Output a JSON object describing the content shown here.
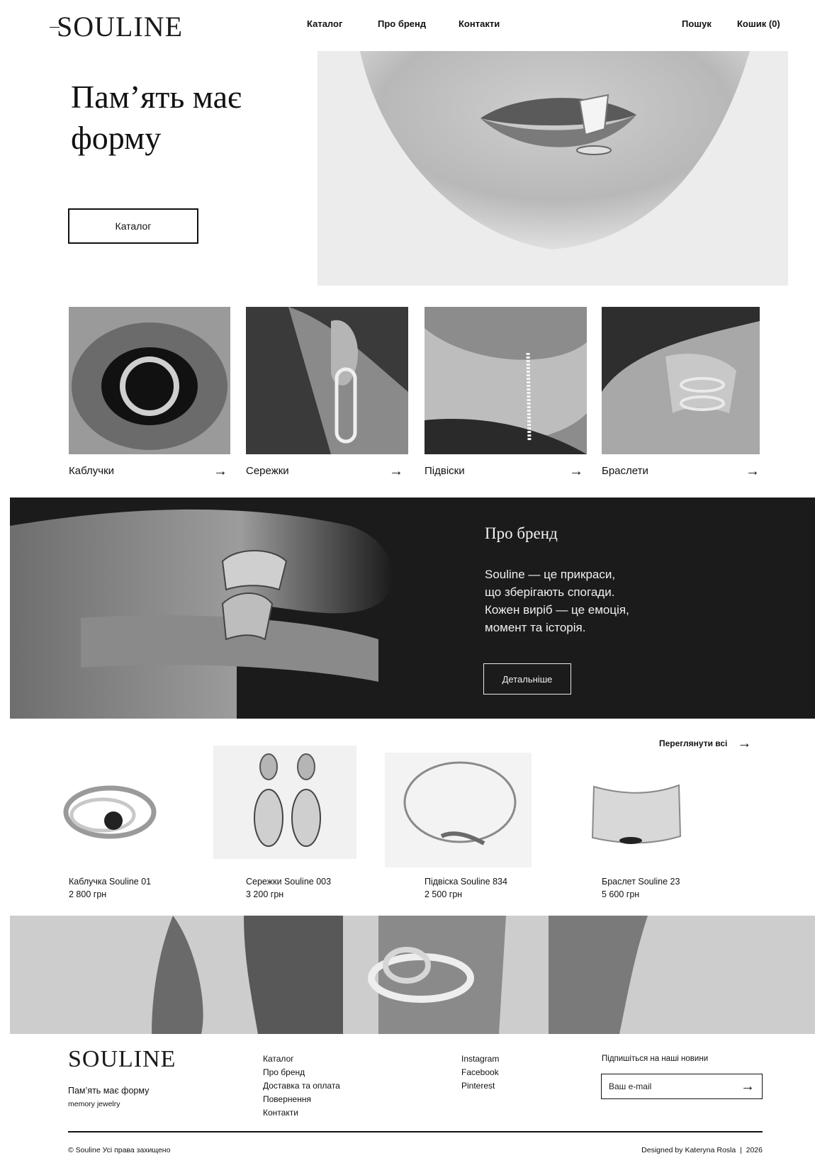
{
  "brand": {
    "logo_text": "SOULINE"
  },
  "nav": {
    "items": [
      "Каталог",
      "Про бренд",
      "Контакти"
    ]
  },
  "utility": {
    "search": "Пошук",
    "cart": "Кошик (0)"
  },
  "hero": {
    "title_line1": "Пам’ять має",
    "title_line2": "форму",
    "button": "Каталог"
  },
  "categories": [
    {
      "label": "Каблучки",
      "arrow": "→"
    },
    {
      "label": "Сережки",
      "arrow": "→"
    },
    {
      "label": "Підвіски",
      "arrow": "→"
    },
    {
      "label": "Браслети",
      "arrow": "→"
    }
  ],
  "about": {
    "title": "Про бренд",
    "lines": [
      "Souline — це прикраси,",
      "що зберігають спогади.",
      "Кожен виріб — це емоція,",
      "момент та історія."
    ],
    "button": "Детальніше"
  },
  "products": {
    "view_all": "Переглянути всі",
    "view_all_arrow": "→",
    "items": [
      {
        "name": "Каблучка Souline 01",
        "price": "2 800 грн"
      },
      {
        "name": "Сережки Souline 003",
        "price": "3 200 грн"
      },
      {
        "name": "Підвіска Souline 834",
        "price": "2 500 грн"
      },
      {
        "name": "Браслет Souline 23",
        "price": "5 600 грн"
      }
    ]
  },
  "footer": {
    "logo_text": "SOULINE",
    "tagline": "Пам’ять має форму",
    "subtag": "memory jewelry",
    "links": [
      "Каталог",
      "Про бренд",
      "Доставка та оплата",
      "Повернення",
      "Контакти"
    ],
    "social": [
      "Instagram",
      "Facebook",
      "Pinterest"
    ],
    "subscribe_title": "Підпишіться на наші новини",
    "email_placeholder": "Ваш e-mail",
    "email_arrow": "→",
    "copyright": "© Souline Усі права захищено",
    "credit": "Designed by Kateryna Rosla  |  2026"
  }
}
